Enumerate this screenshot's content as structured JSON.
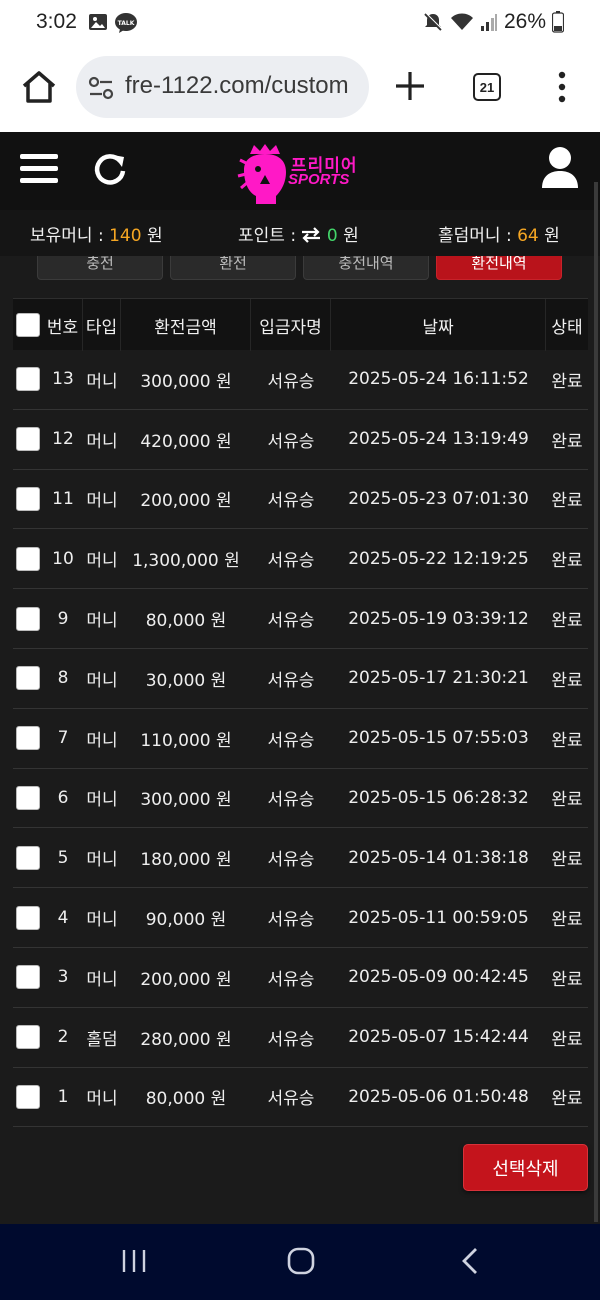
{
  "status_bar": {
    "time": "3:02",
    "battery": "26%",
    "left_icons": [
      "image-icon",
      "kakaotalk-icon"
    ],
    "right_icons": [
      "mute-icon",
      "wifi-icon",
      "signal-icon",
      "battery-icon"
    ],
    "kakao_badge": "TALK"
  },
  "browser": {
    "url": "fre-1122.com/custom",
    "tab_count": "21"
  },
  "header": {
    "logo_title": "프리미어",
    "logo_subtitle": "SPORTS"
  },
  "balance": {
    "money_label": "보유머니 :",
    "money_value": "140",
    "money_unit": "원",
    "point_label": "포인트 :",
    "point_value": "0",
    "point_unit": "원",
    "hold_label": "홀덤머니 :",
    "hold_value": "64",
    "hold_unit": "원"
  },
  "tabs": [
    {
      "label": "충전",
      "active": false
    },
    {
      "label": "환전",
      "active": false
    },
    {
      "label": "충전내역",
      "active": false
    },
    {
      "label": "환전내역",
      "active": true
    }
  ],
  "table": {
    "headers": {
      "no": "번호",
      "type": "타입",
      "amount": "환전금액",
      "name": "입금자명",
      "date": "날짜",
      "status": "상태"
    },
    "rows": [
      {
        "no": "13",
        "type": "머니",
        "amount": "300,000 원",
        "name": "서유승",
        "date": "2025-05-24 16:11:52",
        "status": "완료"
      },
      {
        "no": "12",
        "type": "머니",
        "amount": "420,000 원",
        "name": "서유승",
        "date": "2025-05-24 13:19:49",
        "status": "완료"
      },
      {
        "no": "11",
        "type": "머니",
        "amount": "200,000 원",
        "name": "서유승",
        "date": "2025-05-23 07:01:30",
        "status": "완료"
      },
      {
        "no": "10",
        "type": "머니",
        "amount": "1,300,000 원",
        "name": "서유승",
        "date": "2025-05-22 12:19:25",
        "status": "완료"
      },
      {
        "no": "9",
        "type": "머니",
        "amount": "80,000 원",
        "name": "서유승",
        "date": "2025-05-19 03:39:12",
        "status": "완료"
      },
      {
        "no": "8",
        "type": "머니",
        "amount": "30,000 원",
        "name": "서유승",
        "date": "2025-05-17 21:30:21",
        "status": "완료"
      },
      {
        "no": "7",
        "type": "머니",
        "amount": "110,000 원",
        "name": "서유승",
        "date": "2025-05-15 07:55:03",
        "status": "완료"
      },
      {
        "no": "6",
        "type": "머니",
        "amount": "300,000 원",
        "name": "서유승",
        "date": "2025-05-15 06:28:32",
        "status": "완료"
      },
      {
        "no": "5",
        "type": "머니",
        "amount": "180,000 원",
        "name": "서유승",
        "date": "2025-05-14 01:38:18",
        "status": "완료"
      },
      {
        "no": "4",
        "type": "머니",
        "amount": "90,000 원",
        "name": "서유승",
        "date": "2025-05-11 00:59:05",
        "status": "완료"
      },
      {
        "no": "3",
        "type": "머니",
        "amount": "200,000 원",
        "name": "서유승",
        "date": "2025-05-09 00:42:45",
        "status": "완료"
      },
      {
        "no": "2",
        "type": "홀덤",
        "amount": "280,000 원",
        "name": "서유승",
        "date": "2025-05-07 15:42:44",
        "status": "완료"
      },
      {
        "no": "1",
        "type": "머니",
        "amount": "80,000 원",
        "name": "서유승",
        "date": "2025-05-06 01:50:48",
        "status": "완료"
      }
    ]
  },
  "delete_button_label": "선택삭제",
  "colors": {
    "accent_red": "#c4141c",
    "logo_magenta": "#ff19c6",
    "money_orange": "#f5a623",
    "point_green": "#43d56a"
  }
}
